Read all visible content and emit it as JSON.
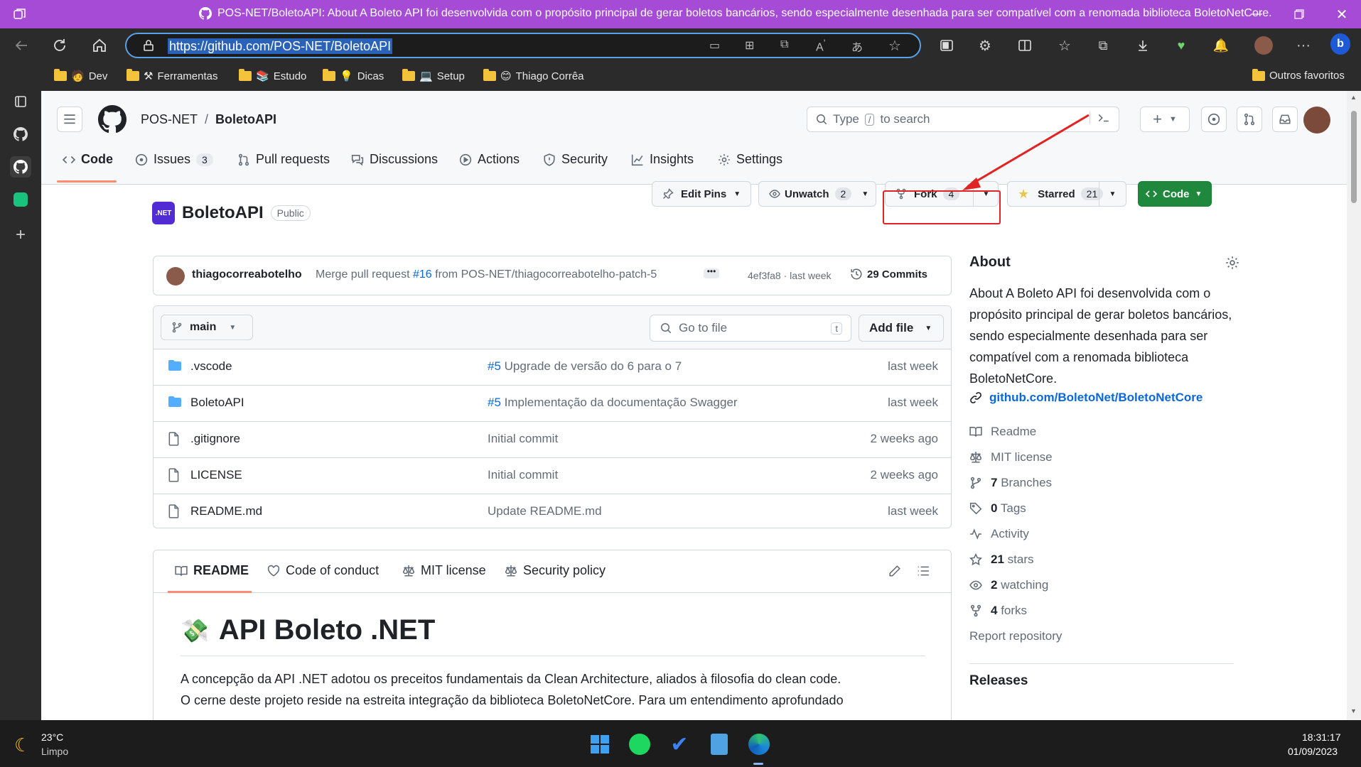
{
  "browser": {
    "window_title": "POS-NET/BoletoAPI: About A Boleto API foi desenvolvida com o propósito principal de gerar boletos bancários, sendo especialmente desenhada para ser compatível com a renomada biblioteca BoletoNetCore.",
    "url": "https://github.com/POS-NET/BoletoAPI",
    "bookmarks": [
      "Dev",
      "Ferramentas",
      "Estudo",
      "Dicas",
      "Setup",
      "Thiago Corrêa"
    ],
    "other_favorites": "Outros favoritos"
  },
  "github_header": {
    "owner": "POS-NET",
    "separator": "/",
    "repo": "BoletoAPI",
    "search_prefix": "Type",
    "search_key": "/",
    "search_suffix": "to search"
  },
  "repo_nav": {
    "tabs": [
      {
        "label": "Code",
        "active": true,
        "icon": "code-icon"
      },
      {
        "label": "Issues",
        "count": "3",
        "icon": "issue-icon"
      },
      {
        "label": "Pull requests",
        "icon": "pull-request-icon"
      },
      {
        "label": "Discussions",
        "icon": "discussion-icon"
      },
      {
        "label": "Actions",
        "icon": "play-icon"
      },
      {
        "label": "Security",
        "icon": "shield-icon"
      },
      {
        "label": "Insights",
        "icon": "graph-icon"
      },
      {
        "label": "Settings",
        "icon": "gear-icon"
      }
    ]
  },
  "repo_header": {
    "badge": ".NET",
    "name": "BoletoAPI",
    "visibility": "Public",
    "edit_pins": "Edit Pins",
    "unwatch": "Unwatch",
    "watch_count": "2",
    "fork": "Fork",
    "fork_count": "4",
    "starred": "Starred",
    "star_count": "21",
    "code_button": "Code"
  },
  "latest_commit": {
    "author": "thiagocorreabotelho",
    "message_prefix": "Merge pull request",
    "pr_link": "#16",
    "message_suffix": "from POS-NET/thiagocorreabotelho-patch-5",
    "sha": "4ef3fa8",
    "dot": "·",
    "time": "last week",
    "commits": "29 Commits"
  },
  "file_toolbar": {
    "branch": "main",
    "go_to_file_placeholder": "Go to file",
    "shortcut": "t",
    "add_file": "Add file"
  },
  "files": [
    {
      "name": ".vscode",
      "type": "folder",
      "message_link": "#5",
      "message": "Upgrade de versão do 6 para o 7",
      "age": "last week"
    },
    {
      "name": "BoletoAPI",
      "type": "folder",
      "message_link": "#5",
      "message": "Implementação da documentação Swagger",
      "age": "last week"
    },
    {
      "name": ".gitignore",
      "type": "file",
      "message_link": "",
      "message": "Initial commit",
      "age": "2 weeks ago"
    },
    {
      "name": "LICENSE",
      "type": "file",
      "message_link": "",
      "message": "Initial commit",
      "age": "2 weeks ago"
    },
    {
      "name": "README.md",
      "type": "file",
      "message_link": "",
      "message": "Update README.md",
      "age": "last week"
    }
  ],
  "readme_tabs": [
    {
      "label": "README",
      "active": true,
      "icon": "book-icon"
    },
    {
      "label": "Code of conduct",
      "icon": "code-of-conduct-icon"
    },
    {
      "label": "MIT license",
      "icon": "law-icon"
    },
    {
      "label": "Security policy",
      "icon": "law-icon"
    }
  ],
  "readme": {
    "emoji": "💸",
    "heading": "API Boleto .NET",
    "paragraph_line1": "A concepção da API .NET adotou os preceitos fundamentais da Clean Architecture, aliados à filosofia do clean code.",
    "paragraph_line2": "O cerne deste projeto reside na estreita integração da biblioteca BoletoNetCore. Para um entendimento aprofundado"
  },
  "about": {
    "title": "About",
    "description": "About A Boleto API foi desenvolvida com o propósito principal de gerar boletos bancários, sendo especialmente desenhada para ser compatível com a renomada biblioteca BoletoNetCore.",
    "link": "github.com/BoletoNet/BoletoNetCore",
    "items": [
      {
        "icon": "book-icon",
        "bold": "",
        "text": "Readme"
      },
      {
        "icon": "law-icon",
        "bold": "",
        "text": "MIT license"
      },
      {
        "icon": "branch-icon",
        "bold": "7",
        "text": "Branches"
      },
      {
        "icon": "tag-icon",
        "bold": "0",
        "text": "Tags"
      },
      {
        "icon": "pulse-icon",
        "bold": "",
        "text": "Activity"
      },
      {
        "icon": "star-icon",
        "bold": "21",
        "text": "stars"
      },
      {
        "icon": "eye-icon",
        "bold": "2",
        "text": "watching"
      },
      {
        "icon": "fork-icon",
        "bold": "4",
        "text": "forks"
      }
    ],
    "report": "Report repository",
    "releases": "Releases"
  },
  "taskbar": {
    "temperature": "23°C",
    "weather": "Limpo",
    "time": "18:31:17",
    "date": "01/09/2023"
  },
  "colors": {
    "accent_blue": "#0969da",
    "code_button": "#1f883d",
    "highlight_red": "#e02424",
    "title_bar": "#a64bd6"
  }
}
